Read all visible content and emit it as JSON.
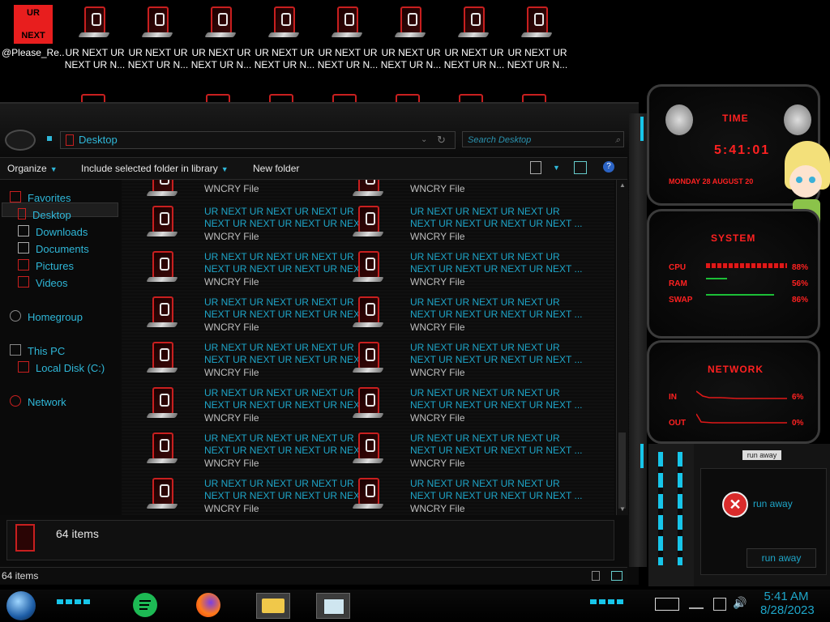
{
  "desktop": {
    "icons": [
      {
        "label": "@Please_Re...",
        "box_top": "UR",
        "box_bottom": "NEXT",
        "type": "ransom-note"
      },
      {
        "label1": "UR NEXT UR",
        "label2": "NEXT UR N..."
      },
      {
        "label1": "UR NEXT UR",
        "label2": "NEXT UR N..."
      },
      {
        "label1": "UR NEXT UR",
        "label2": "NEXT UR N..."
      },
      {
        "label1": "UR NEXT UR",
        "label2": "NEXT UR N..."
      },
      {
        "label1": "UR NEXT UR",
        "label2": "NEXT UR N..."
      },
      {
        "label1": "UR NEXT UR",
        "label2": "NEXT UR N..."
      },
      {
        "label1": "UR NEXT UR",
        "label2": "NEXT UR N..."
      },
      {
        "label1": "UR NEXT UR",
        "label2": "NEXT UR N..."
      }
    ]
  },
  "explorer": {
    "address": "Desktop",
    "search_placeholder": "Search Desktop",
    "toolbar": {
      "organize": "Organize",
      "include": "Include selected folder in library",
      "new_folder": "New folder"
    },
    "nav": {
      "favorites": "Favorites",
      "desktop": "Desktop",
      "downloads": "Downloads",
      "documents": "Documents",
      "pictures": "Pictures",
      "videos": "Videos",
      "homegroup": "Homegroup",
      "this_pc": "This PC",
      "local_disk": "Local Disk (C:)",
      "network": "Network"
    },
    "file_partial_type": "WNCRY File",
    "file": {
      "line1": "UR NEXT UR NEXT UR NEXT UR",
      "line2": "NEXT UR NEXT UR NEXT UR NEXT ...",
      "type": "WNCRY File"
    },
    "rows": 7,
    "details_count": "64 items",
    "status_count": "64 items"
  },
  "gadgets": {
    "time": {
      "title": "TIME",
      "clock": "5:41:01",
      "date": "MONDAY 28 AUGUST 20"
    },
    "system": {
      "title": "SYSTEM",
      "cpu_label": "CPU",
      "ram_label": "RAM",
      "swap_label": "SWAP",
      "cpu": "88%",
      "ram": "56%",
      "swap": "86%"
    },
    "network": {
      "title": "NETWORK",
      "in_label": "IN",
      "out_label": "OUT",
      "in": "6%",
      "out": "0%"
    },
    "dialog": {
      "title": "run away",
      "message": "run away",
      "button": "run away"
    }
  },
  "taskbar": {
    "time": "5:41 AM",
    "date": "8/28/2023"
  },
  "colors": {
    "accent": "#1ea6c9",
    "red": "#ff2121",
    "bg": "#000000"
  }
}
